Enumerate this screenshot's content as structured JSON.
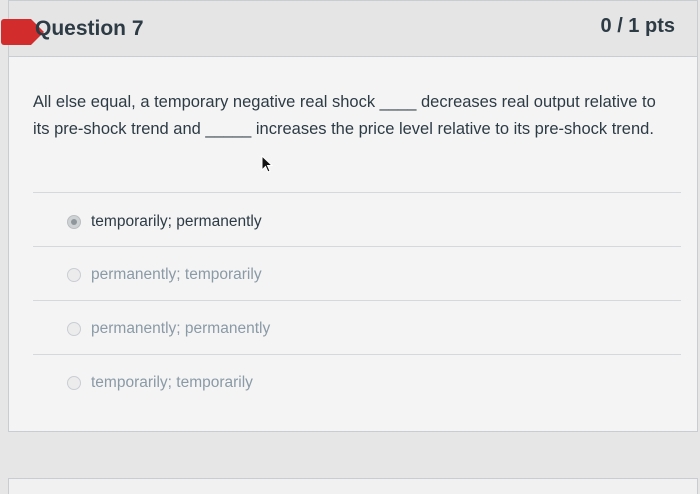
{
  "question": {
    "title": "Question 7",
    "points": "0 / 1 pts",
    "text": "All else equal, a temporary negative real shock ____ decreases real output relative to its pre-shock trend and _____ increases the price level relative to its pre-shock trend."
  },
  "answers": [
    {
      "label": "temporarily; permanently",
      "selected": true
    },
    {
      "label": "permanently; temporarily",
      "selected": false
    },
    {
      "label": "permanently; permanently",
      "selected": false
    },
    {
      "label": "temporarily; temporarily",
      "selected": false
    }
  ],
  "colors": {
    "flag": "#d22c2c",
    "text": "#2d3b45",
    "muted_answer": "#8a9aa6",
    "header_bg": "#e5e5e5",
    "card_bg": "#f4f4f4"
  }
}
